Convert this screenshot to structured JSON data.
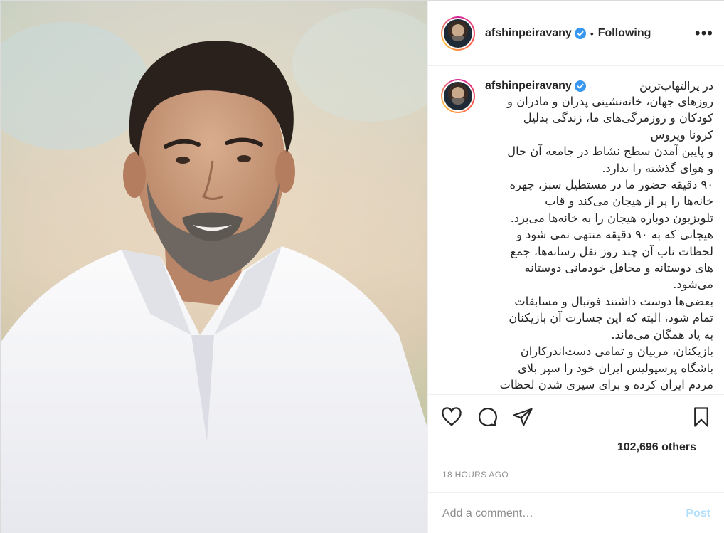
{
  "post": {
    "username": "afshinpeiravany",
    "follow_status": "Following",
    "separator": "•",
    "caption_first": "در پرالتهاب‌ترین",
    "caption_text": "روزهای جهان، خانه‌نشینی پدران و مادران و\nکودکان و روزمرگی‌های ما، زندگی بدلیل\nکرونا ویروس\nو پایین آمدن سطح نشاط در جامعه آن حال\nو هوای گذشته را ندارد.\n۹۰ دقیقه حضور ما در مستطیل سبز، چهره\nخانه‌ها را پر از هیجان می‌کند و قاب\nتلویزیون دوباره هیجان را به خانه‌ها می‌برد.\nهیجانی که به ۹۰ دقیقه منتهی نمی شود و\nلحظات ناب آن چند روز نقل رسانه‌ها، جمع\nهای دوستانه و محافل خودمانی دوستانه\nمی‌شود.\nبعضی‌ها دوست داشتند فوتبال و مسابقات\nتمام شود، البته که این جسارت آن بازیکنان\nبه یاد همگان می‌ماند.\nبازیکنان، مربیان و تمامی دست‌اندرکاران\nباشگاه پرسپولیس ایران خود را سپر بلای\nمردم ایران کرده و برای سپری شدن لحظات",
    "likes": "102,696 others",
    "timestamp": "18 HOURS AGO",
    "comment_placeholder": "Add a comment…",
    "post_button": "Post",
    "more_label": "•••"
  },
  "icons": {
    "verified": "verified-badge-icon",
    "more": "more-options-icon",
    "like": "heart-icon",
    "comment": "comment-icon",
    "share": "share-icon",
    "save": "bookmark-icon"
  },
  "colors": {
    "verified_blue": "#3897f0",
    "post_button_disabled": "#b2dffc",
    "muted_text": "#8e8e8e"
  }
}
